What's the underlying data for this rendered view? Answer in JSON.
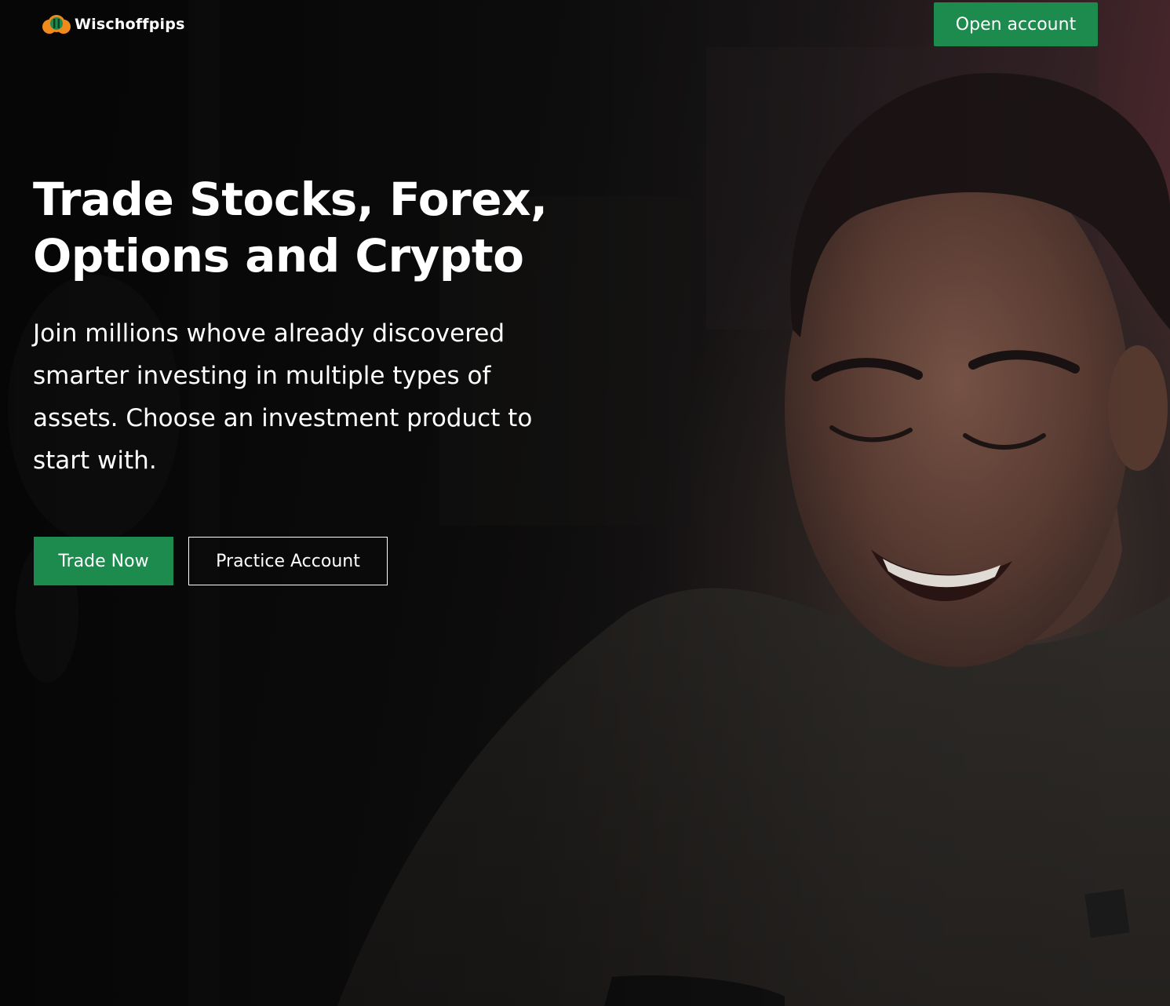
{
  "brand": {
    "name": "Wischoffpips",
    "logo_icon": "green-orange-coin-logo"
  },
  "nav": {
    "open_account_label": "Open account"
  },
  "hero": {
    "headline_line1": "Trade Stocks, Forex,",
    "headline_line2": "Options and Crypto",
    "subtitle": "Join millions whove already discovered smarter investing in multiple types of assets. Choose an investment product to start with.",
    "primary_cta_label": "Trade Now",
    "secondary_cta_label": "Practice Account",
    "background_image": "smiling-man-photo"
  },
  "colors": {
    "accent_green": "#1d8a4e",
    "logo_orange": "#f08a1c",
    "text": "#ffffff",
    "background_dark": "#0b0b0b",
    "background_tint": "#5a2d34"
  }
}
